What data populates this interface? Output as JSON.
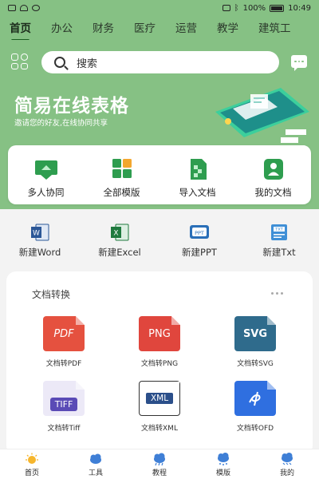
{
  "status_bar": {
    "battery": "100%",
    "time": "10:49"
  },
  "tabs": [
    {
      "label": "首页",
      "active": true
    },
    {
      "label": "办公"
    },
    {
      "label": "财务"
    },
    {
      "label": "医疗"
    },
    {
      "label": "运营"
    },
    {
      "label": "教学"
    },
    {
      "label": "建筑工"
    }
  ],
  "search": {
    "placeholder": "搜索"
  },
  "hero": {
    "title": "简易在线表格",
    "subtitle": "邀请您的好友,在线协同共享"
  },
  "quick_actions": [
    {
      "label": "多人协同",
      "icon": "collaboration-icon"
    },
    {
      "label": "全部模版",
      "icon": "templates-icon"
    },
    {
      "label": "导入文档",
      "icon": "import-document-icon"
    },
    {
      "label": "我的文档",
      "icon": "my-documents-icon"
    }
  ],
  "new_docs": [
    {
      "label": "新建Word",
      "icon": "word-icon",
      "badge": "W",
      "color": "#2b5797"
    },
    {
      "label": "新建Excel",
      "icon": "excel-icon",
      "badge": "X",
      "color": "#1f7a3e"
    },
    {
      "label": "新建PPT",
      "icon": "ppt-icon",
      "badge": "PPT",
      "color": "#2a6fb8"
    },
    {
      "label": "新建Txt",
      "icon": "txt-icon",
      "badge": "TXT",
      "color": "#3f8fd6"
    }
  ],
  "convert": {
    "title": "文档转换",
    "items": [
      {
        "label": "文档转PDF",
        "badge": "PDF",
        "color": "#e5513f",
        "icon": "pdf-file-icon"
      },
      {
        "label": "文档转PNG",
        "badge": "PNG",
        "color": "#e0463d",
        "icon": "png-file-icon"
      },
      {
        "label": "文档转SVG",
        "badge": "SVG",
        "color": "#2f6b8c",
        "icon": "svg-file-icon"
      },
      {
        "label": "文档转Tiff",
        "badge": "TIFF",
        "color": "#5a4bb6",
        "icon": "tiff-file-icon"
      },
      {
        "label": "文档转XML",
        "badge": "XML",
        "color": "#2b4f8a",
        "icon": "xml-file-icon"
      },
      {
        "label": "文档转OFD",
        "badge": "",
        "color": "#2f6fe0",
        "icon": "ofd-file-icon"
      }
    ]
  },
  "bottom_nav": [
    {
      "label": "首页",
      "icon": "home-sun-icon",
      "active": true
    },
    {
      "label": "工具",
      "icon": "tools-icon"
    },
    {
      "label": "教程",
      "icon": "tutorial-icon"
    },
    {
      "label": "模版",
      "icon": "templates-nav-icon"
    },
    {
      "label": "我的",
      "icon": "profile-icon"
    }
  ]
}
